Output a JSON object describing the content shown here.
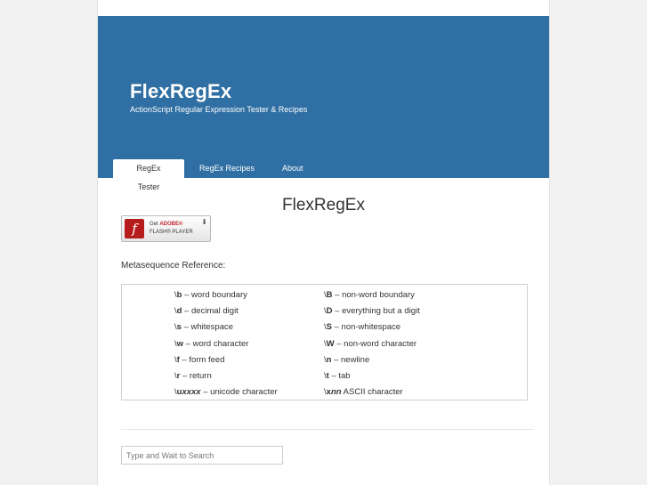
{
  "site": {
    "title": "FlexRegEx",
    "description": "ActionScript Regular Expression Tester & Recipes"
  },
  "nav": {
    "items": [
      {
        "label": "RegEx Tester",
        "active": true
      },
      {
        "label": "RegEx Recipes",
        "active": false
      },
      {
        "label": "About",
        "active": false
      }
    ]
  },
  "main": {
    "title": "FlexRegEx",
    "flash_badge": {
      "line1_prefix": "Get ",
      "line1_brand": "ADOBE®",
      "line2": "FLASH® PLAYER",
      "icon": "flash-logo-icon"
    },
    "meta_label": "Metasequence Reference:",
    "metasequences": [
      [
        {
          "code": "b",
          "desc": " – word boundary"
        },
        {
          "code": "B",
          "desc": " – non-word boundary"
        }
      ],
      [
        {
          "code": "d",
          "desc": " – decimal digit"
        },
        {
          "code": "D",
          "desc": " – everything but a digit"
        }
      ],
      [
        {
          "code": "s",
          "desc": " – whitespace"
        },
        {
          "code": "S",
          "desc": " – non-whitespace"
        }
      ],
      [
        {
          "code": "w",
          "desc": " – word character"
        },
        {
          "code": "W",
          "desc": " – non-word character"
        }
      ],
      [
        {
          "code": "f",
          "desc": " – form feed"
        },
        {
          "code": "n",
          "desc": " – newline"
        }
      ],
      [
        {
          "code": "r",
          "desc": " – return"
        },
        {
          "code": "t",
          "desc": " – tab"
        }
      ],
      [
        {
          "code": "u",
          "italic": "xxxx",
          "desc": " – unicode character"
        },
        {
          "code": "x",
          "italic": "nn",
          "desc": " ASCII character"
        }
      ]
    ]
  },
  "search": {
    "placeholder": "Type and Wait to Search"
  },
  "colors": {
    "header_bg": "#2f6fa3",
    "page_bg": "#f1f1f1"
  }
}
